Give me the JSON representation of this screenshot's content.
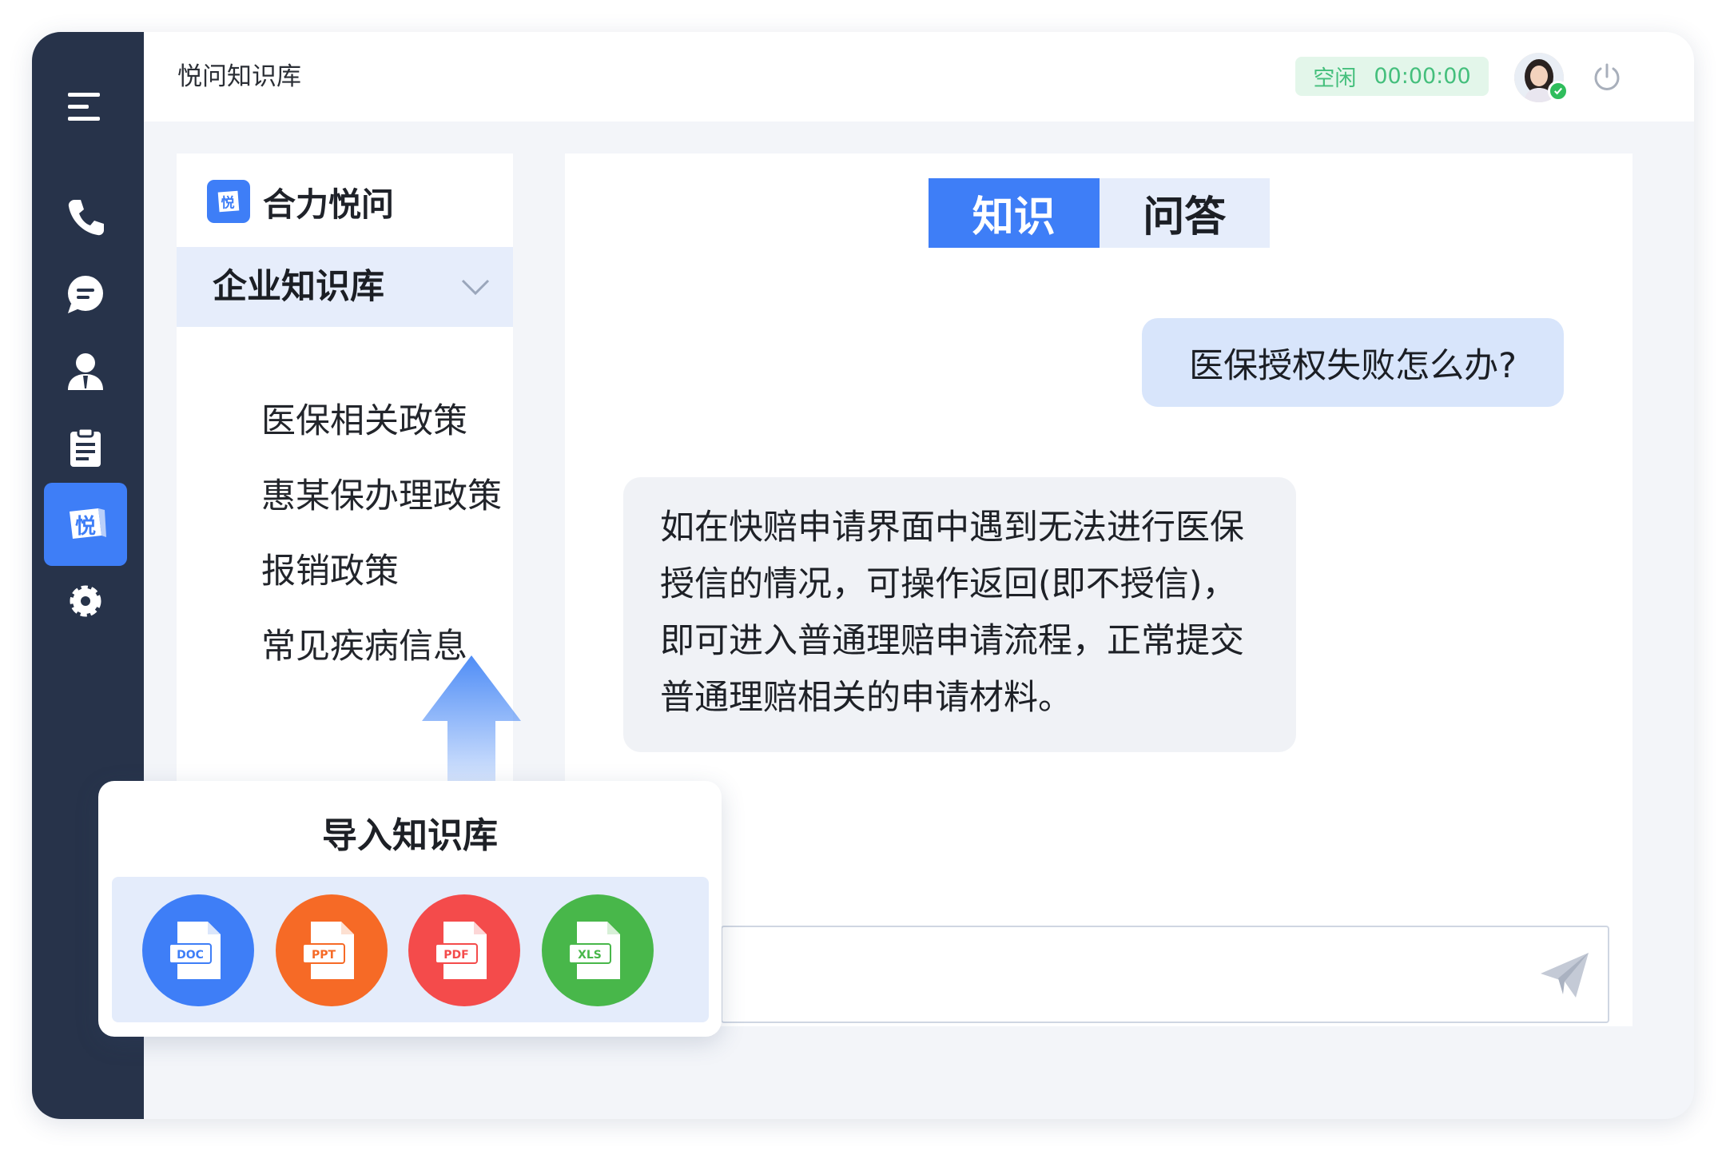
{
  "app": {
    "title": "悦问知识库"
  },
  "status": {
    "label": "空闲",
    "timer": "00:00:00",
    "color": "#44bf7c"
  },
  "sidebar_icons": [
    "menu-icon",
    "phone-icon",
    "chat-icon",
    "user-icon",
    "clipboard-icon",
    "yuewen-icon",
    "gear-icon"
  ],
  "brand": {
    "name": "合力悦问",
    "logo_glyph": "悦"
  },
  "knowledge_base": {
    "header": "企业知识库",
    "items": [
      {
        "label": "医保相关政策"
      },
      {
        "label": "惠某保办理政策"
      },
      {
        "label": "报销政策"
      },
      {
        "label": "常见疾病信息"
      }
    ]
  },
  "import": {
    "title": "导入知识库",
    "types": [
      {
        "label": "DOC",
        "color": "#3e7ef7"
      },
      {
        "label": "PPT",
        "color": "#f66a26"
      },
      {
        "label": "PDF",
        "color": "#f44b4b"
      },
      {
        "label": "XLS",
        "color": "#48b74a"
      }
    ]
  },
  "tabs": [
    {
      "label": "知识",
      "active": true
    },
    {
      "label": "问答",
      "active": false
    }
  ],
  "conversation": {
    "question": "医保授权失败怎么办?",
    "answer_lines": [
      "如在快赔申请界面中遇到无法进行医保",
      "授信的情况，可操作返回(即不授信)，",
      "即可进入普通理赔申请流程，正常提交",
      "普通理赔相关的申请材料。"
    ]
  },
  "colors": {
    "accent": "#3e7ef7",
    "rail": "#27334a",
    "background": "#f3f5f9"
  }
}
